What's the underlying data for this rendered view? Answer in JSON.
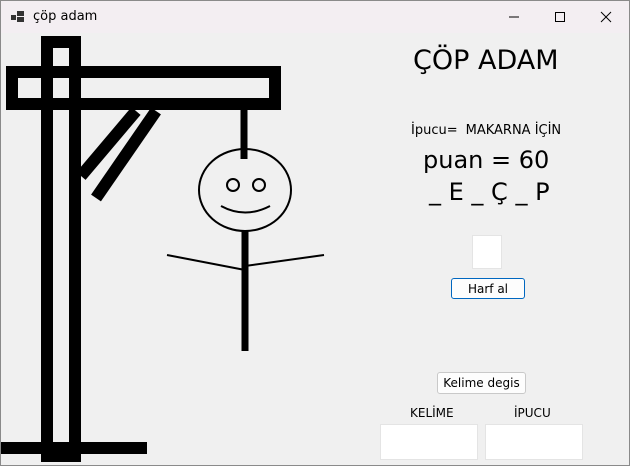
{
  "window": {
    "title": "çöp adam",
    "icons": {
      "app": "app-window-icon",
      "minimize": "minimize-icon",
      "maximize": "maximize-icon",
      "close": "close-icon"
    }
  },
  "game": {
    "title": "ÇÖP ADAM",
    "hint_label": "İpucu=",
    "hint_value": "MAKARNA İÇİN",
    "score_text": "puan = 60",
    "word_display": "_ E _ Ç _ P"
  },
  "letter_input": {
    "value": "",
    "placeholder": ""
  },
  "buttons": {
    "take_letter": "Harf al",
    "change_word": "Kelime degis"
  },
  "fields": {
    "word_label": "KELİME",
    "hint_label": "İPUCU",
    "word_value": "",
    "hint_value": ""
  },
  "drawing": {
    "parts": [
      "gallows",
      "rope",
      "head",
      "face",
      "body",
      "arms"
    ]
  },
  "colors": {
    "titlebar": "#f3eef2",
    "background": "#f0f0f0",
    "button_focus_border": "#0067c0",
    "drawing": "#000000"
  }
}
